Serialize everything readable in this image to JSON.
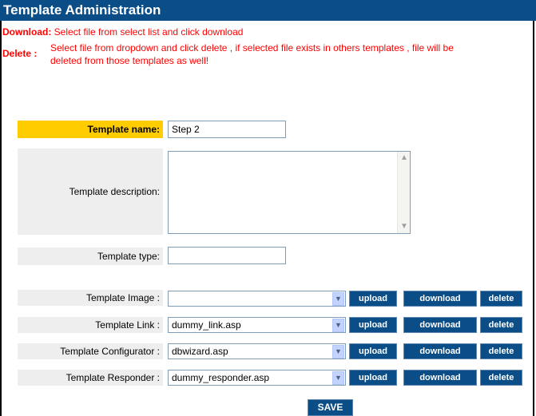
{
  "header": {
    "title": "Template Administration"
  },
  "notices": {
    "download_label": "Download:",
    "download_text": "Select file from select list and click download",
    "delete_label": "Delete :",
    "delete_text_line1": "Select file from dropdown and click delete , if selected file exists in others templates , file will be",
    "delete_text_line2": "deleted from those templates as well!"
  },
  "form": {
    "template_name_label": "Template name:",
    "template_name_value": "Step 2",
    "template_description_label": "Template description:",
    "template_description_value": "",
    "template_type_label": "Template type:",
    "template_type_value": ""
  },
  "file_rows": [
    {
      "label": "Template Image :",
      "selected": ""
    },
    {
      "label": "Template Link :",
      "selected": "dummy_link.asp"
    },
    {
      "label": "Template Configurator :",
      "selected": "dbwizard.asp"
    },
    {
      "label": "Template Responder :",
      "selected": "dummy_responder.asp"
    }
  ],
  "buttons": {
    "upload": "upload",
    "download": "download",
    "delete": "delete",
    "save": "SAVE"
  }
}
